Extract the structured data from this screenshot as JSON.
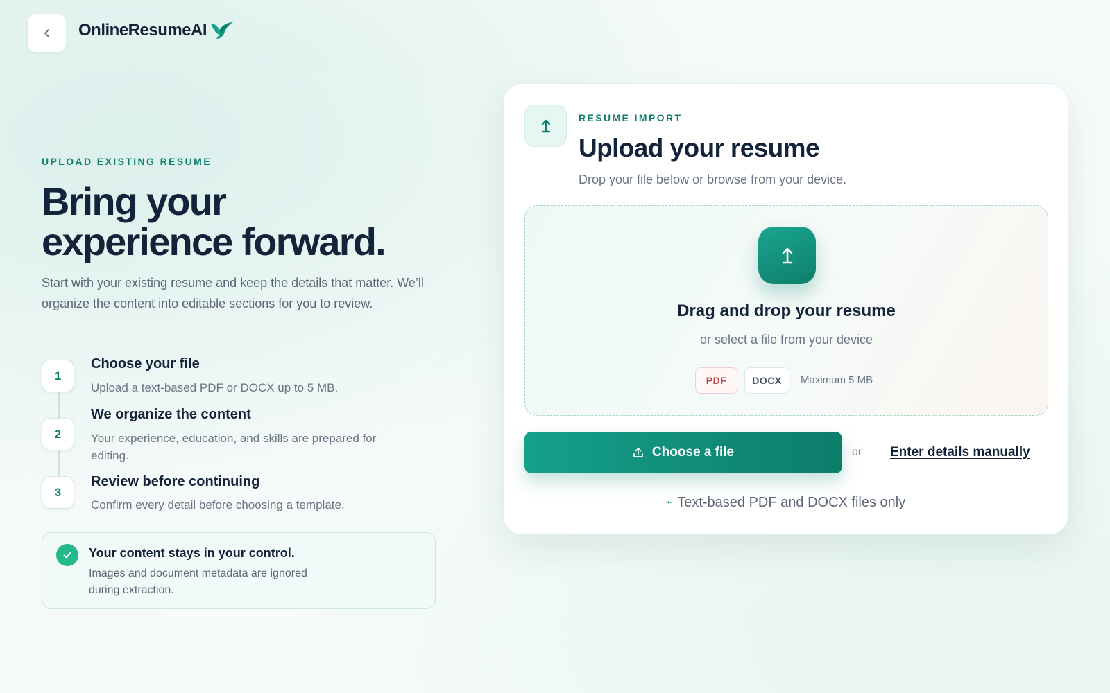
{
  "header": {
    "logo_text": "OnlineResumeAI"
  },
  "intro": {
    "eyebrow": "UPLOAD EXISTING RESUME",
    "title_line1": "Bring your",
    "title_line2": "experience forward.",
    "description": "Start with your existing resume and keep the details that matter. We’ll organize the content into editable sections for you to review."
  },
  "steps": [
    {
      "number": "1",
      "title": "Choose your file",
      "description": "Upload a text-based PDF or DOCX up to 5 MB."
    },
    {
      "number": "2",
      "title": "We organize the content",
      "description": "Your experience, education, and skills are prepared for editing."
    },
    {
      "number": "3",
      "title": "Review before continuing",
      "description": "Confirm every detail before choosing a template."
    }
  ],
  "privacy": {
    "title": "Your content stays in your control.",
    "description": "Images and document metadata are ignored during extraction."
  },
  "card": {
    "eyebrow": "RESUME IMPORT",
    "title": "Upload your resume",
    "subtitle": "Drop your file below or browse from your device.",
    "dropzone": {
      "title": "Drag and drop your resume",
      "subtitle": "or select a file from your device",
      "formats": [
        "PDF",
        "DOCX"
      ],
      "max_size": "Maximum 5 MB"
    },
    "choose_button": "Choose a file",
    "or": "or",
    "manual_link": "Enter details manually",
    "note": "Text-based PDF and DOCX files only"
  },
  "colors": {
    "accent": "#0f7f6d",
    "accent_light": "#19a58c",
    "heading": "#13233a",
    "check": "#23b98a",
    "pdf": "#c0424a"
  },
  "icons": {
    "back": "chevron-left-icon",
    "logo": "bird-icon",
    "upload": "upload-arrow-icon",
    "check": "check-icon",
    "note": "spark-icon"
  }
}
